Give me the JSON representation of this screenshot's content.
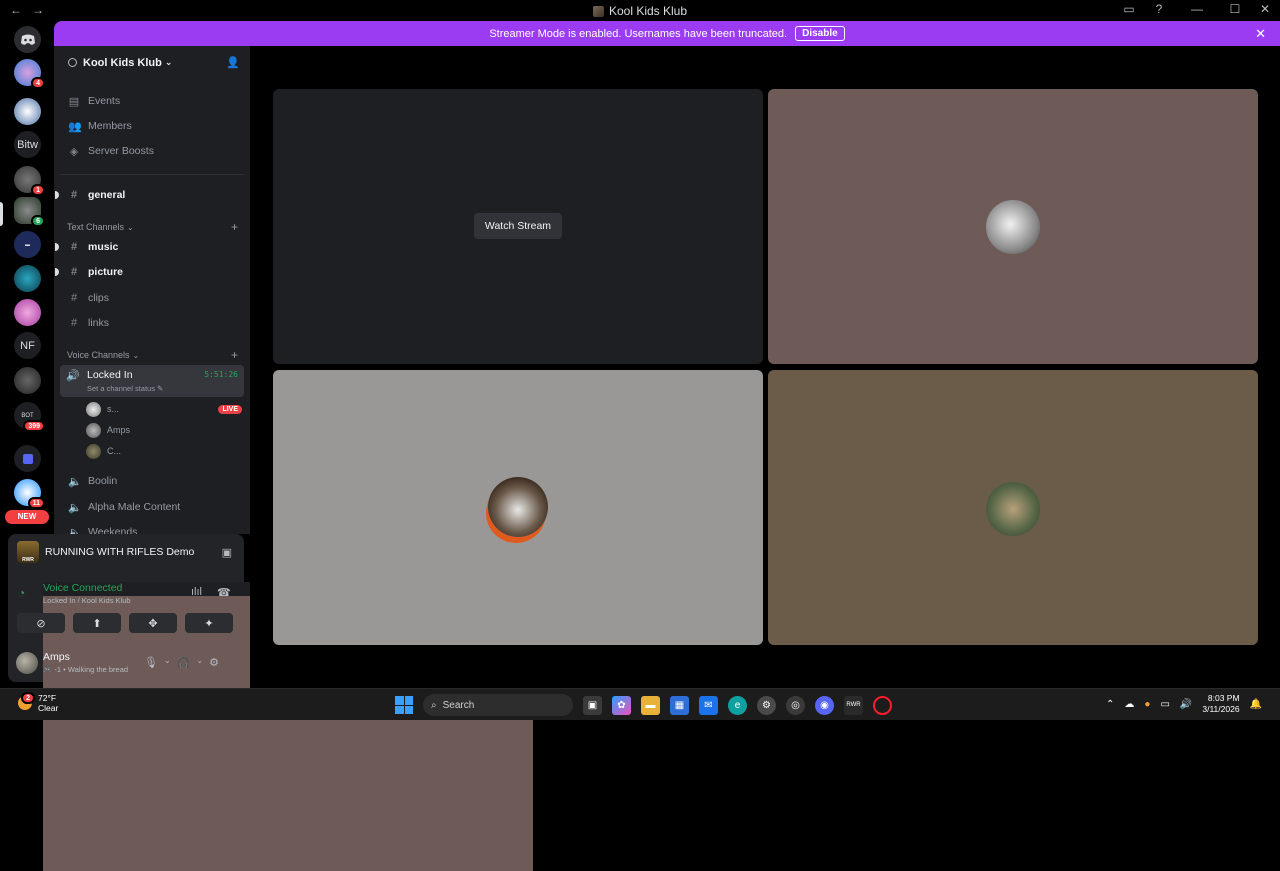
{
  "window": {
    "title": "Kool Kids Klub",
    "back": "←",
    "forward": "→"
  },
  "banner": {
    "text": "Streamer Mode is enabled. Usernames have been truncated.",
    "button": "Disable"
  },
  "rail": {
    "bitw_label": "Bitw",
    "nf_label": "NF",
    "new_tag": "NEW",
    "badges": {
      "s1": "4",
      "s5": "1",
      "s6": "6",
      "s12": "399",
      "s14": "11"
    },
    "mini_label": "BOT"
  },
  "sidebar": {
    "guild_name": "Kool Kids Klub",
    "items": [
      {
        "label": "Events",
        "icon": "calendar-icon"
      },
      {
        "label": "Members",
        "icon": "members-icon"
      },
      {
        "label": "Server Boosts",
        "icon": "boost-icon"
      }
    ],
    "general": "general",
    "text_category": "Text Channels",
    "text_channels": [
      "music",
      "picture",
      "clips",
      "links"
    ],
    "voice_category": "Voice Channels",
    "active_voice": {
      "name": "Locked In",
      "status": "Set a channel status",
      "timer": "5:51:26"
    },
    "members": [
      {
        "name": "s...",
        "live": "LIVE"
      },
      {
        "name": "Amps"
      },
      {
        "name": "C..."
      }
    ],
    "voice_channels": [
      "Boolin",
      "Alpha Male Content",
      "Weekends"
    ]
  },
  "panel": {
    "activity": "RUNNING WITH RIFLES Demo",
    "activity_icon_text": "RWR",
    "voice_title": "Voice Connected",
    "voice_sub": "Locked In / Kool Kids Klub",
    "user_name": "Amps",
    "user_status": "🎮 -1 • Walking the bread"
  },
  "stage": {
    "watch_label": "Watch Stream"
  },
  "taskbar": {
    "temp": "72°F",
    "condition": "Clear",
    "search": "Search",
    "time": "8:03 PM",
    "date": "3/11/2026",
    "weather_badge": "2"
  },
  "colors": {
    "accent": "#9b3cf2",
    "green": "#23a55a",
    "red": "#f23f42"
  }
}
